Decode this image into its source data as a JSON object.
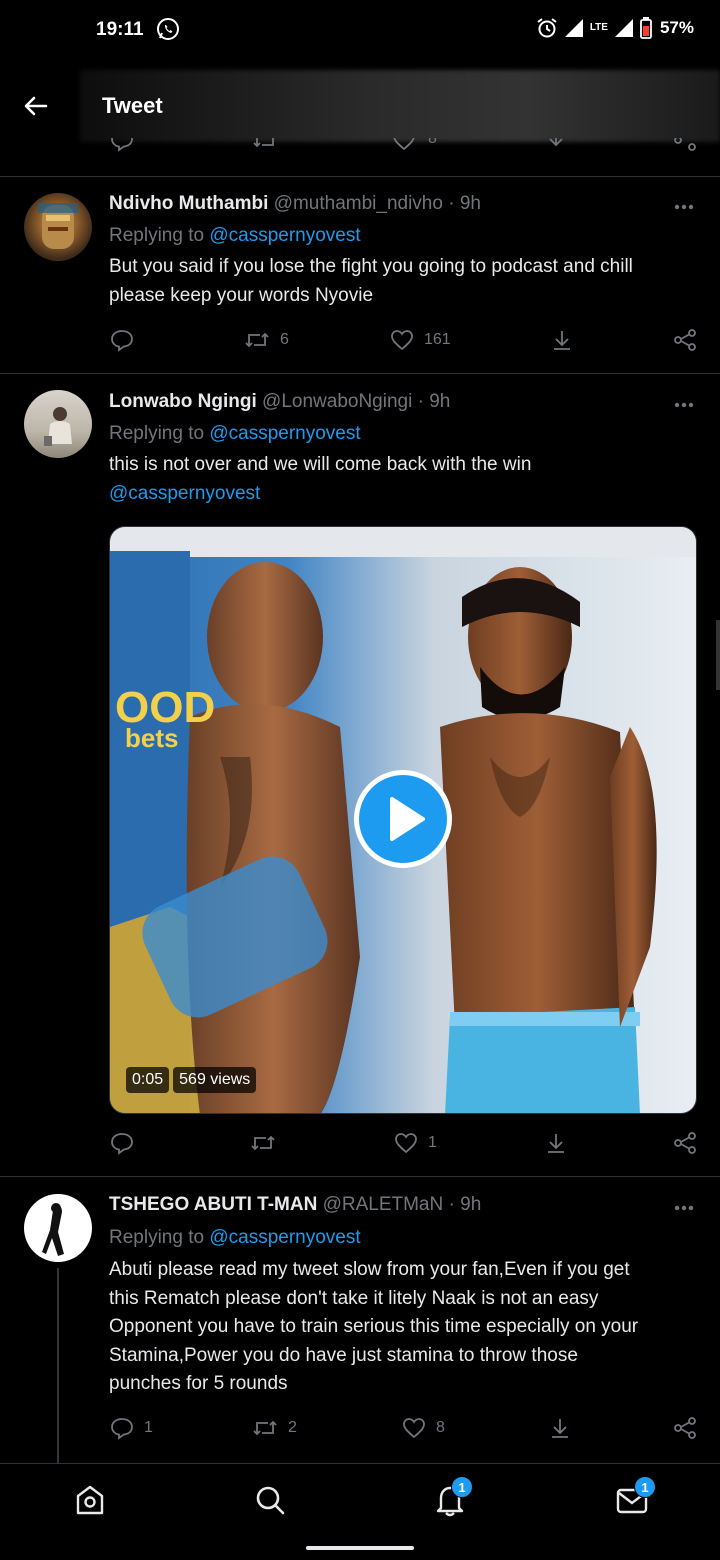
{
  "status_bar": {
    "time": "19:11",
    "battery": "57%",
    "network": "LTE"
  },
  "header": {
    "title": "Tweet"
  },
  "prev_actions": {
    "likes": "8"
  },
  "tweets": [
    {
      "name": "Ndivho Muthambi",
      "handle": "@muthambi_ndivho",
      "time": "· 9h",
      "replying_prefix": "Replying to",
      "replying_to": "@casspernyovest",
      "lines": [
        "But you said if you lose the fight you going to podcast and chill",
        "please keep your words Nyovie"
      ],
      "replies": "",
      "retweets": "6",
      "likes": "161"
    },
    {
      "name": "Lonwabo Ngingi",
      "handle": "@LonwaboNgingi",
      "time": "· 9h",
      "replying_prefix": "Replying to",
      "replying_to": "@casspernyovest",
      "lines": [
        "this is not over and we will come back with the win"
      ],
      "mention_line": "@casspernyovest",
      "video": {
        "duration": "0:05",
        "views": "569 views",
        "banner_text_1": "OOD",
        "banner_text_2": "bets"
      },
      "replies": "",
      "retweets": "",
      "likes": "1"
    },
    {
      "name": "TSHEGO ABUTI T-MAN",
      "handle": "@RALETMaN",
      "time": "· 9h",
      "replying_prefix": "Replying to",
      "replying_to": "@casspernyovest",
      "lines": [
        "Abuti please read my tweet slow from your fan,Even if you get",
        "this Rematch please don't take it litely Naak is not an easy",
        "Opponent you have to train serious this time especially on your",
        "Stamina,Power you do have just stamina to throw those",
        "punches for 5 rounds"
      ],
      "replies": "1",
      "retweets": "2",
      "likes": "8"
    }
  ],
  "bottom_nav": {
    "notifications_badge": "1",
    "messages_badge": "1"
  },
  "icons": [
    "whatsapp-icon",
    "alarm-icon",
    "signal-icon",
    "battery-icon",
    "back-arrow-icon",
    "more-icon",
    "reply-icon",
    "retweet-icon",
    "like-icon",
    "share-icon",
    "analytics-icon",
    "play-icon",
    "home-icon",
    "search-icon",
    "bell-icon",
    "mail-icon"
  ],
  "colors": {
    "accent": "#1d9bf0",
    "muted": "#71767b",
    "background": "#000000",
    "text": "#e7e9ea"
  }
}
